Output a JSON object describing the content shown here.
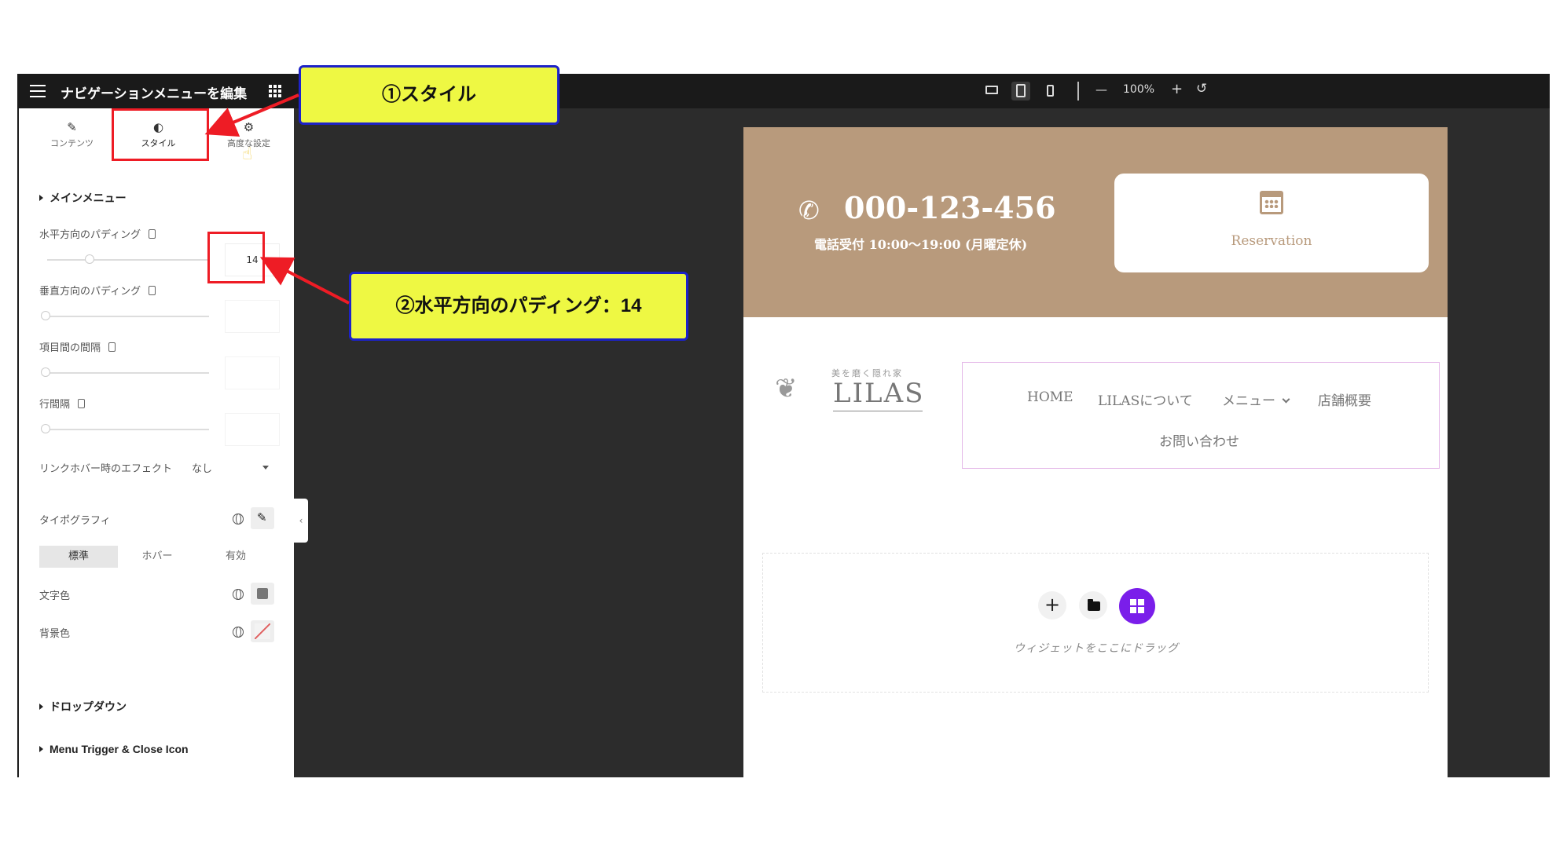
{
  "topbar": {
    "title": "ナビゲーションメニューを編集",
    "zoom_minus": "—",
    "zoom": "100%",
    "zoom_plus": "+",
    "reset": "↺"
  },
  "tabs": [
    {
      "label": "コンテンツ",
      "icon": "✎"
    },
    {
      "label": "スタイル",
      "icon": "◐"
    },
    {
      "label": "高度な設定",
      "icon": "⚙"
    }
  ],
  "main_menu": {
    "heading": "メインメニュー",
    "horizontal_padding_label": "水平方向のパディング",
    "horizontal_padding_value": "14",
    "horizontal_padding_fraction": 0.26,
    "vertical_padding_label": "垂直方向のパディング",
    "item_spacing_label": "項目間の間隔",
    "line_spacing_label": "行間隔",
    "hover_effect_label": "リンクホバー時のエフェクト",
    "hover_effect_value": "なし",
    "typography_label": "タイポグラフィ",
    "states": [
      "標準",
      "ホバー",
      "有効"
    ],
    "text_color_label": "文字色",
    "bg_color_label": "背景色",
    "text_color": "#777777"
  },
  "sections": {
    "dropdown": "ドロップダウン",
    "trigger": "Menu Trigger & Close Icon"
  },
  "page": {
    "phone": "000-123-456",
    "hours": "電話受付 10:00〜19:00 (月曜定休)",
    "reservation": "Reservation",
    "logo_tagline": "美を磨く隠れ家",
    "logo_name": "LILAS",
    "nav": [
      "HOME",
      "LILASについて",
      "メニュー",
      "店舗概要",
      "お問い合わせ"
    ],
    "drop_hint": "ウィジェットをここにドラッグ",
    "header_color": "#b89a7c",
    "accent": "#7a1eea"
  },
  "annotations": {
    "callout1": "①スタイル",
    "callout2": "②水平方向のパディング：14",
    "box_color": "#ee1c25",
    "callout_fill": "#eef843",
    "callout_border": "#1d22c8"
  }
}
